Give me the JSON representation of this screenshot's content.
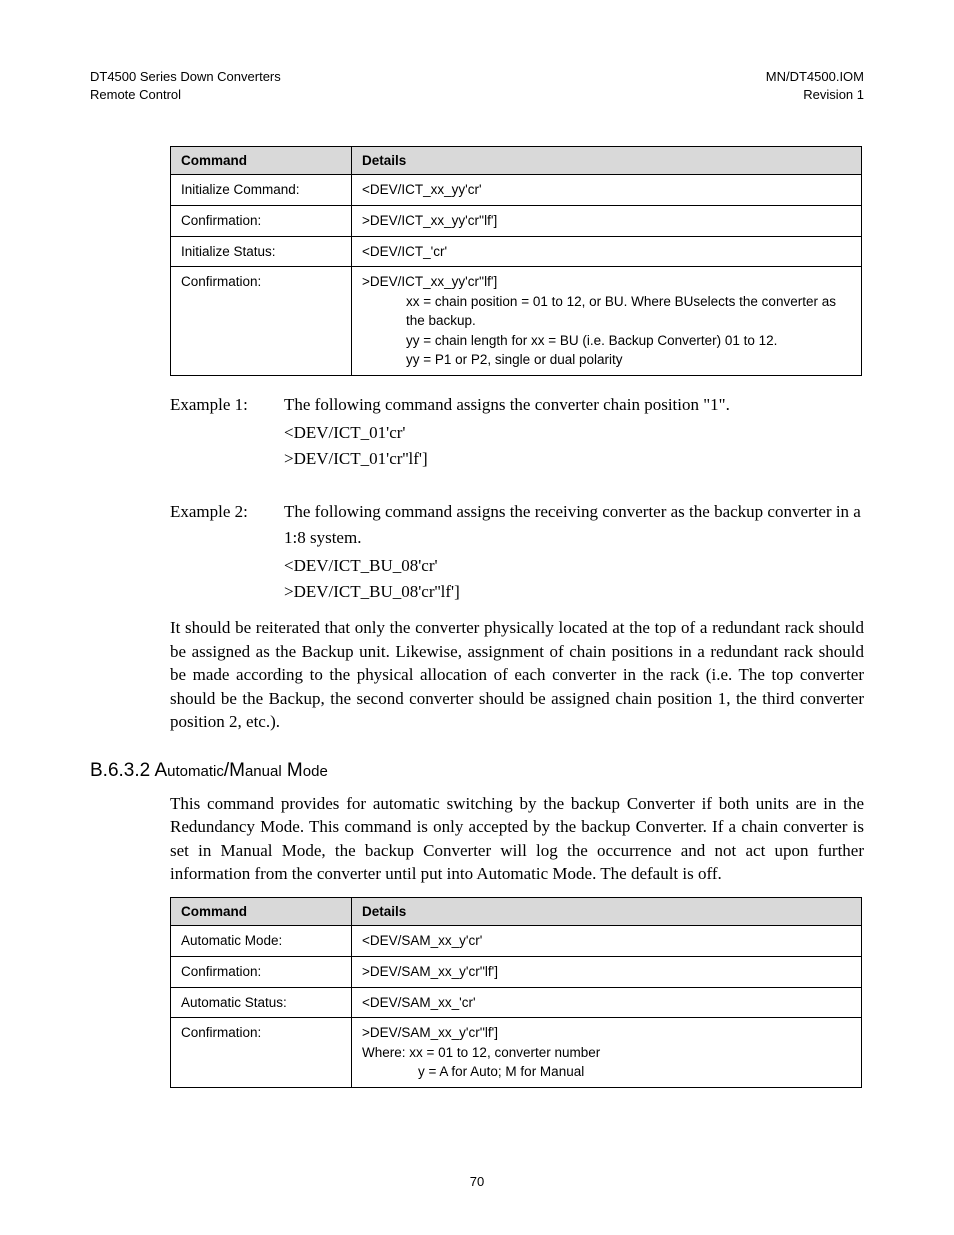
{
  "header": {
    "left1": "DT4500 Series Down Converters",
    "left2": "Remote Control",
    "right1": "MN/DT4500.IOM",
    "right2": "Revision 1"
  },
  "table1": {
    "head_cmd": "Command",
    "head_det": "Details",
    "rows": {
      "r1c1": "Initialize Command:",
      "r1c2": "<DEV/ICT_xx_yy'cr'",
      "r2c1": "Confirmation:",
      "r2c2": ">DEV/ICT_xx_yy'cr''lf']",
      "r3c1": "Initialize Status:",
      "r3c2": "<DEV/ICT_'cr'",
      "r4c1": "Confirmation:",
      "r4c2a": ">DEV/ICT_xx_yy'cr''lf']",
      "r4c2b": "xx = chain position = 01 to 12, or BU. Where BUselects the converter as the backup.",
      "r4c2c": "yy = chain length for xx = BU (i.e. Backup Converter) 01 to 12.",
      "r4c2d": "yy = P1 or P2, single or dual polarity"
    }
  },
  "examples": {
    "ex1_label": "Example 1:",
    "ex1_text": "The following command assigns the converter chain position \"1\".",
    "ex1_l1": "<DEV/ICT_01'cr'",
    "ex1_l2": ">DEV/ICT_01'cr''lf']",
    "ex2_label": "Example 2:",
    "ex2_text": "The following command assigns the receiving converter as the backup converter in a 1:8 system.",
    "ex2_l1": "<DEV/ICT_BU_08'cr'",
    "ex2_l2": ">DEV/ICT_BU_08'cr''lf']"
  },
  "para1": "It should be reiterated that only the converter physically located at the top of a redundant rack should be assigned as the Backup unit.  Likewise, assignment of chain positions in a redundant rack should be made according to the physical allocation of each converter in the rack  (i.e. The top converter should be the Backup, the second converter should be assigned chain position 1, the third converter position 2, etc.).",
  "section": {
    "num": "B.6.3.2",
    "title_a": "A",
    "title_b": "utomatic",
    "title_c": "/M",
    "title_d": "anual",
    "title_e": " M",
    "title_f": "ode"
  },
  "para2": "This command provides for automatic switching by the backup Converter if both units are in the Redundancy Mode.  This command is only accepted by the backup Converter.  If a chain converter is set in Manual Mode, the backup Converter will log the occurrence and not act upon further information from the converter until put into Automatic Mode.  The default is off.",
  "table2": {
    "head_cmd": "Command",
    "head_det": "Details",
    "rows": {
      "r1c1": "Automatic Mode:",
      "r1c2": "<DEV/SAM_xx_y'cr'",
      "r2c1": "Confirmation:",
      "r2c2": ">DEV/SAM_xx_y'cr''lf']",
      "r3c1": "Automatic Status:",
      "r3c2": "<DEV/SAM_xx_'cr'",
      "r4c1": "Confirmation:",
      "r4c2a": ">DEV/SAM_xx_y'cr''lf']",
      "r4c2b": "Where:  xx = 01 to 12, converter number",
      "r4c2c": "y = A for Auto; M for Manual"
    }
  },
  "page_number": "70"
}
